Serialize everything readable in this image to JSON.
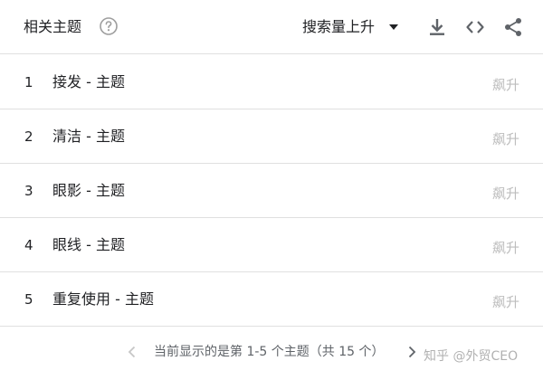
{
  "header": {
    "title": "相关主题",
    "help_icon": "question-circle-icon",
    "sort_label": "搜索量上升",
    "tools": [
      "download-icon",
      "embed-code-icon",
      "share-icon"
    ]
  },
  "rows": [
    {
      "rank": "1",
      "label": "接发 - 主题",
      "value": "飙升"
    },
    {
      "rank": "2",
      "label": "清洁 - 主题",
      "value": "飙升"
    },
    {
      "rank": "3",
      "label": "眼影 - 主题",
      "value": "飙升"
    },
    {
      "rank": "4",
      "label": "眼线 - 主题",
      "value": "飙升"
    },
    {
      "rank": "5",
      "label": "重复使用 - 主题",
      "value": "飙升"
    }
  ],
  "footer": {
    "pagination_text": "当前显示的是第 1-5 个主题（共 15 个）"
  },
  "watermark": "知乎 @外贸CEO",
  "colors": {
    "text": "#202124",
    "muted": "#bdbdbd",
    "icon": "#5f6368",
    "divider": "#e0e0e0"
  }
}
